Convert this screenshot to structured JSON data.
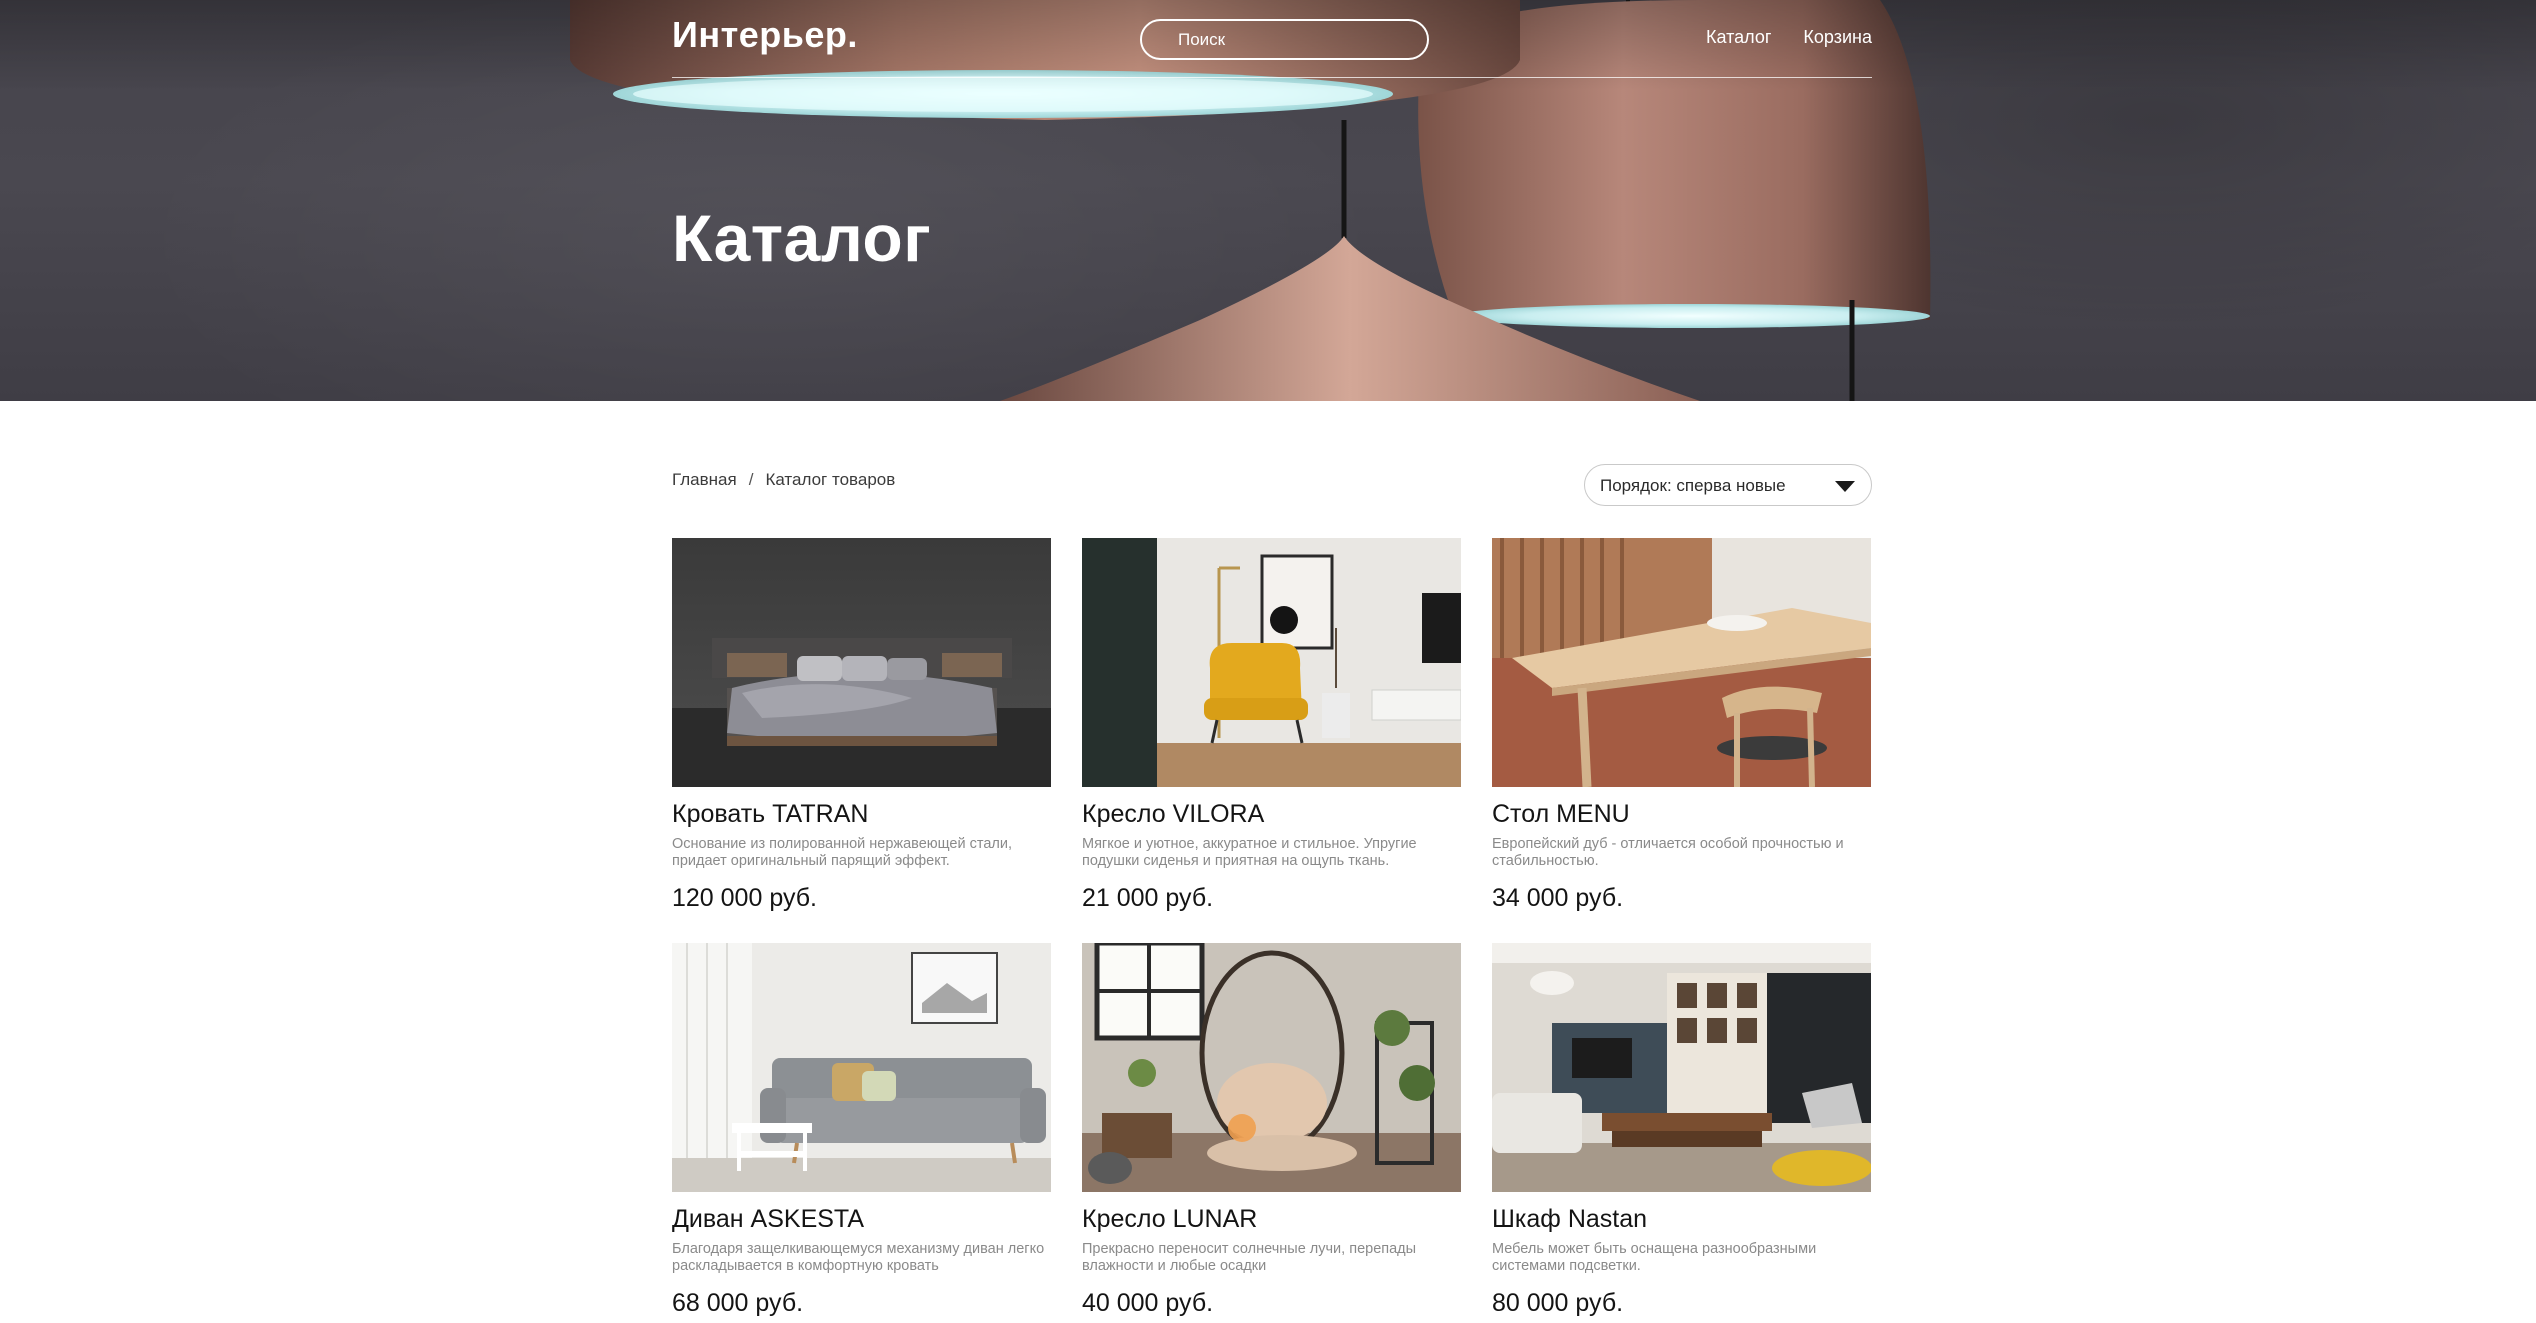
{
  "header": {
    "logo": "Интерьер.",
    "search_placeholder": "Поиск",
    "nav": [
      "Каталог",
      "Корзина"
    ]
  },
  "hero": {
    "title": "Каталог"
  },
  "breadcrumb": {
    "home": "Главная",
    "separator": "/",
    "current": "Каталог товаров"
  },
  "sort": {
    "label": "Порядок: сперва новые"
  },
  "products": [
    {
      "name": "Кровать TATRAN",
      "desc": "Основание из полированной нержавеющей стали, придает оригинальный парящий эффект.",
      "price": "120 000 руб."
    },
    {
      "name": "Кресло VILORA",
      "desc": "Мягкое и уютное, аккуратное и стильное. Упругие подушки сиденья и приятная на ощупь ткань.",
      "price": "21 000 руб."
    },
    {
      "name": "Стол MENU",
      "desc": "Европейский дуб - отличается особой прочностью и стабильностью.",
      "price": "34 000 руб."
    },
    {
      "name": "Диван ASKESTA",
      "desc": "Благодаря защелкивающемуся механизму диван легко раскладывается в комфортную кровать",
      "price": "68 000 руб."
    },
    {
      "name": "Кресло LUNAR",
      "desc": "Прекрасно переносит солнечные лучи, перепады влажности и любые осадки",
      "price": "40 000 руб."
    },
    {
      "name": "Шкаф Nastan",
      "desc": "Мебель может быть оснащена разнообразными системами подсветки.",
      "price": "80 000 руб."
    }
  ]
}
